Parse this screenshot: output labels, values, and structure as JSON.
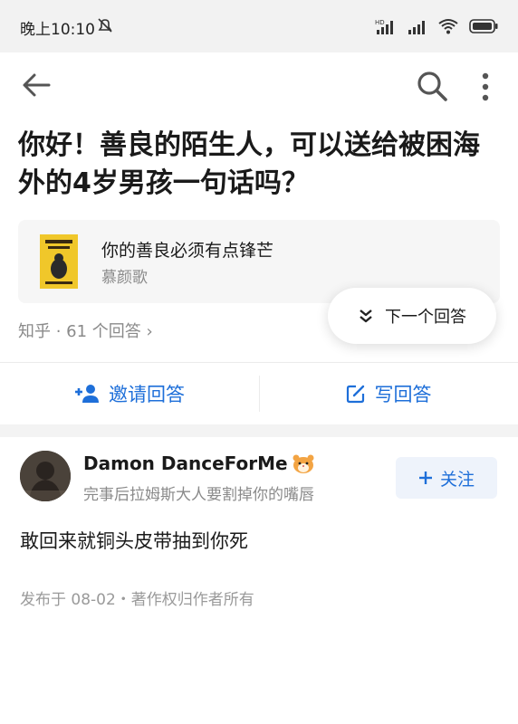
{
  "status_bar": {
    "time": "晚上10:10",
    "icons": [
      "mute-bell-icon",
      "hd-signal-icon",
      "signal-icon",
      "wifi-icon",
      "battery-icon"
    ]
  },
  "nav": {
    "icons": [
      "back-arrow-icon",
      "search-icon",
      "more-vertical-icon"
    ]
  },
  "question": {
    "title": "你好！善良的陌生人，可以送给被困海外的4岁男孩一句话吗？"
  },
  "book_card": {
    "title": "你的善良必须有点锋芒",
    "author": "慕颜歌",
    "cover_color": "#f0c72a"
  },
  "meta": {
    "text": "知乎 · 61 个回答",
    "chevron": "›"
  },
  "next_button": {
    "icon": "double-chevron-down-icon",
    "label": "下一个回答"
  },
  "actions": {
    "invite_label": "邀请回答",
    "write_label": "写回答",
    "accent": "#1e6fd9"
  },
  "answer": {
    "author_name": "Damon DanceForMe",
    "author_badge": "hamster-emoji",
    "bio": "完事后拉姆斯大人要割掉你的嘴唇",
    "follow_label": "关注",
    "content": "敢回来就铜头皮带抽到你死",
    "footer": "发布于 08-02・著作权归作者所有"
  }
}
